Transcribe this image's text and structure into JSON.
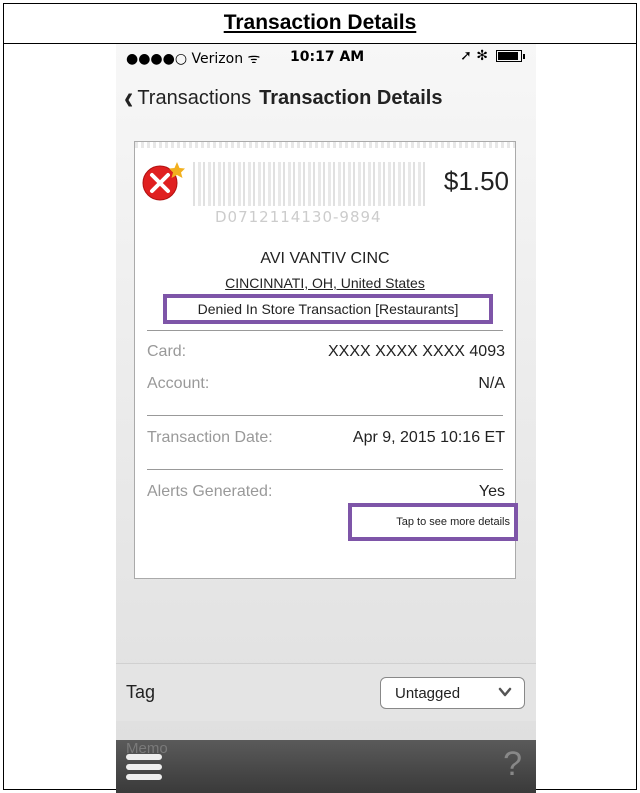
{
  "document": {
    "title": "Transaction Details"
  },
  "status_bar": {
    "carrier": "●●●●○ Verizon ᯤ",
    "time": "10:17 AM",
    "icons": "➚ ✻",
    "battery_level": 0.9
  },
  "nav": {
    "back_label": "Transactions",
    "title": "Transaction Details"
  },
  "receipt": {
    "status_icon": "denied-x-star-icon",
    "barcode_number": "D0712114130-9894",
    "amount": "$1.50",
    "merchant_name": "AVI VANTIV CINC",
    "merchant_location": "CINCINNATI, OH, United States",
    "transaction_type": "Denied In Store Transaction [Restaurants]",
    "card_label": "Card:",
    "card_value": "XXXX XXXX XXXX 4093",
    "account_label": "Account:",
    "account_value": "N/A",
    "date_label": "Transaction Date:",
    "date_value": "Apr 9, 2015 10:16 ET",
    "alerts_label": "Alerts Generated:",
    "alerts_value": "Yes",
    "more_details": "Tap to see more details"
  },
  "tag": {
    "label": "Tag",
    "selected": "Untagged"
  },
  "tab_bar": {
    "memo_label": "Memo",
    "help": "?"
  },
  "colors": {
    "highlight": "#7e55a8",
    "denied_red": "#e02020",
    "star_gold": "#f2b01e"
  }
}
